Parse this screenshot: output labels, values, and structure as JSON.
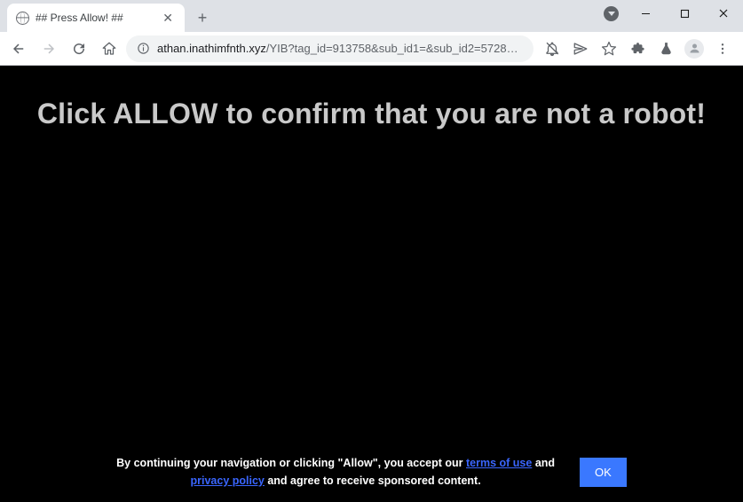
{
  "tab": {
    "title": "## Press Allow! ##"
  },
  "omnibox": {
    "domain": "athan.inathimfnth.xyz",
    "path_truncated": "/YIB?tag_id=913758&sub_id1=&sub_id2=5728299101610730531&c..."
  },
  "page": {
    "headline": "Click ALLOW to confirm that you are not a robot!",
    "legal_pre": "By continuing your navigation or clicking \"Allow\", you accept our ",
    "terms_link": "terms of use",
    "legal_mid": " and ",
    "privacy_link": "privacy policy",
    "legal_post": " and agree to receive sponsored content.",
    "ok": "OK"
  }
}
